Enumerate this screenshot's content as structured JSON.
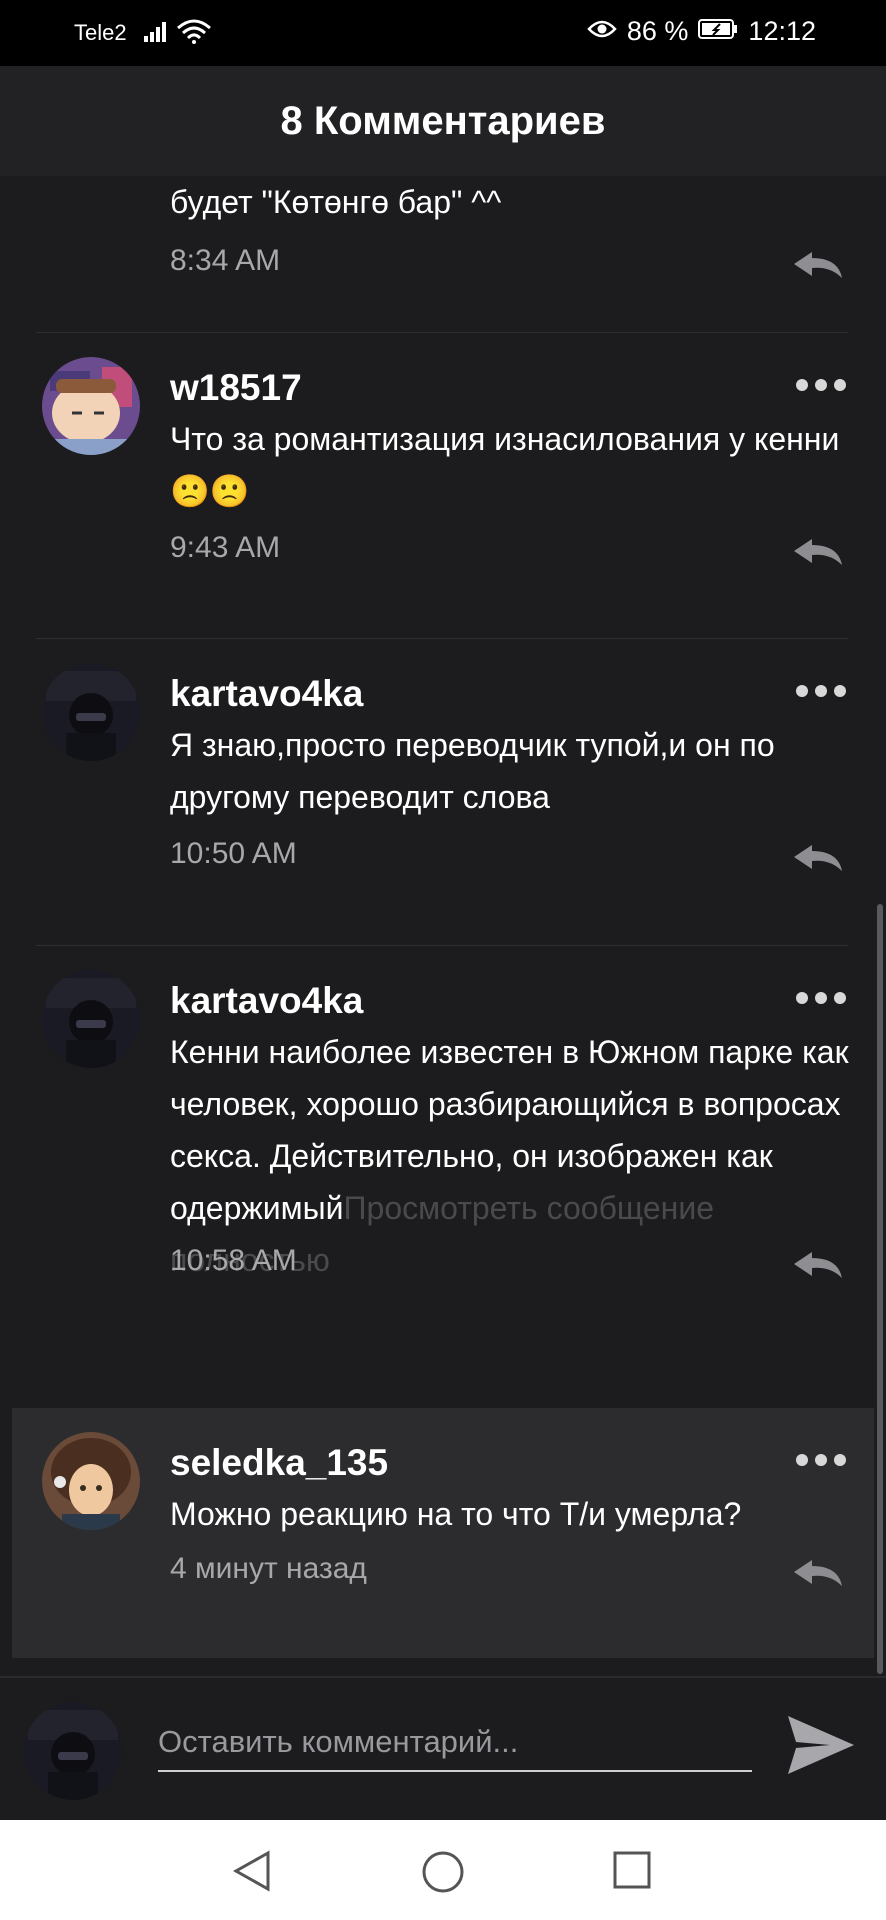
{
  "status_bar": {
    "carrier": "Tele2",
    "battery_percent": "86 %",
    "time": "12:12"
  },
  "header": {
    "title": "8 Комментариев"
  },
  "comments": [
    {
      "text": "будет \"Көтөнгө бар\" ^^",
      "time": "8:34 AM"
    },
    {
      "author": "w18517",
      "text": "Что за романтизация изнасилования у кенни",
      "emoji": "🙁🙁",
      "time": "9:43 AM"
    },
    {
      "author": "kartavo4ka",
      "text": "Я знаю,просто переводчик тупой,и он по другому переводит слова",
      "time": "10:50 AM"
    },
    {
      "author": "kartavo4ka",
      "text": "Кенни наиболее известен в Южном парке как человек, хорошо разбирающийся в вопросах секса. Действительно, он изображен как одержимый",
      "more_link": "Просмотреть сообщение полностью",
      "time": "10:58 AM"
    },
    {
      "author": "seledka_135",
      "text": "Можно реакцию на то что Т/и умерла?",
      "time": "4 минут назад"
    }
  ],
  "composer": {
    "placeholder": "Оставить комментарий..."
  },
  "icons": {
    "more": "more-dots-icon",
    "reply": "reply-icon",
    "send": "send-icon",
    "nav_back": "back-triangle-icon",
    "nav_home": "home-circle-icon",
    "nav_recents": "recents-square-icon"
  },
  "colors": {
    "background": "#1c1c1e",
    "header": "#222224",
    "highlight": "#2c2c2e",
    "secondary_text": "#a8a8ac"
  }
}
